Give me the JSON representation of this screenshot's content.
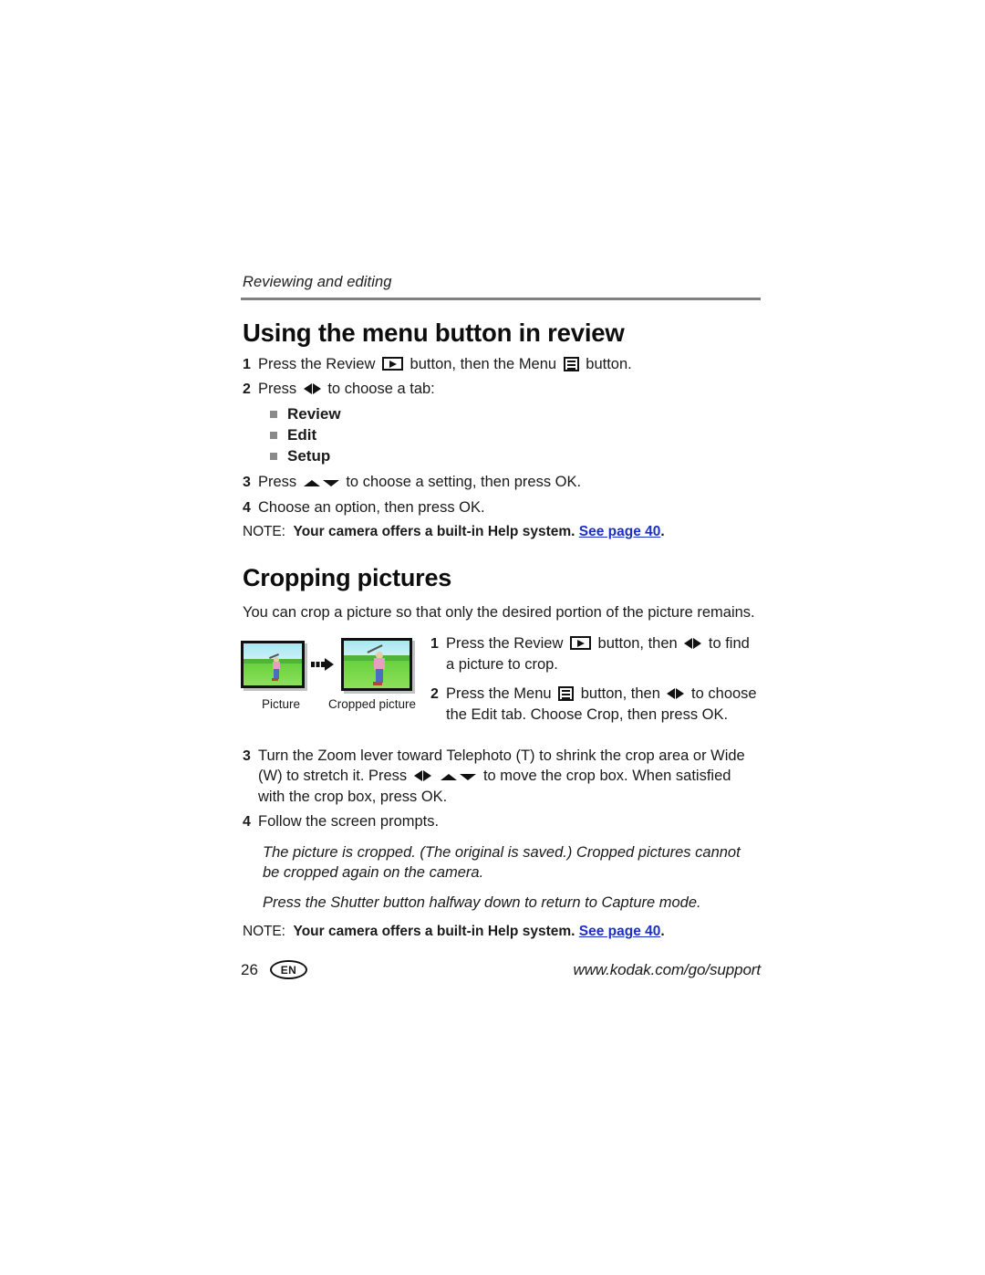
{
  "page": {
    "running_header": "Reviewing and editing",
    "page_number": "26",
    "language_badge": "EN",
    "footer_url": "www.kodak.com/go/support"
  },
  "colors": {
    "link_blue": "#1c2fc8",
    "rule_gray": "#808080",
    "bullet_gray": "#8a8a8a",
    "text": "#1a1a1a"
  },
  "section_menu": {
    "title": "Using the menu button in review",
    "steps": [
      {
        "num": "1",
        "parts": {
          "p1": "Press the Review ",
          "icon1": "review-button-icon",
          "p2": " button, then the Menu ",
          "icon2": "menu-button-icon",
          "p3": " button."
        }
      },
      {
        "num": "2",
        "parts": {
          "p1": "Press ",
          "icon1": "left-right-arrows-icon",
          "p2": " to choose a tab:"
        }
      },
      {
        "num": "3",
        "parts": {
          "p1": "Press ",
          "icon1": "up-down-arrows-icon",
          "p2": " to choose a setting, then press OK."
        }
      },
      {
        "num": "4",
        "parts": {
          "p1": "Choose an option, then press OK."
        }
      }
    ],
    "tabs": [
      {
        "label": "Review"
      },
      {
        "label": "Edit"
      },
      {
        "label": "Setup"
      }
    ],
    "note": {
      "label": "NOTE:",
      "bold_text": "Your camera offers a built-in Help system.",
      "link_text": "See page 40",
      "tail": "."
    }
  },
  "section_crop": {
    "title": "Cropping pictures",
    "intro": "You can crop a picture so that only the desired portion of the picture remains.",
    "figure": {
      "caption_before": "Picture",
      "caption_after": "Cropped picture",
      "arrow": "right-arrow-icon"
    },
    "steps": [
      {
        "num": "1",
        "parts": {
          "p1": "Press the Review ",
          "icon1": "review-button-icon",
          "p2": " button, then ",
          "icon2": "left-right-arrows-icon",
          "p3": " to find a picture to crop."
        }
      },
      {
        "num": "2",
        "parts": {
          "p1": "Press the Menu ",
          "icon1": "menu-button-icon",
          "p2": " button, then ",
          "icon2": "left-right-arrows-icon",
          "p3": " to choose the Edit tab. Choose Crop, then press OK."
        }
      },
      {
        "num": "3",
        "parts": {
          "p1": "Turn the Zoom lever toward Telephoto (T) to shrink the crop area or Wide (W) to stretch it. Press ",
          "icon1": "left-right-arrows-icon",
          "p2": " ",
          "icon2": "up-down-arrows-icon",
          "p3": " to move the crop box. When satisfied with the crop box, press OK."
        }
      },
      {
        "num": "4",
        "parts": {
          "p1": "Follow the screen prompts."
        }
      }
    ],
    "italic_notes": [
      "The picture is cropped. (The original is saved.) Cropped pictures cannot be cropped again on the camera.",
      "Press the Shutter button halfway down to return to Capture mode."
    ],
    "note": {
      "label": "NOTE:",
      "bold_text": "Your camera offers a built-in Help system.",
      "link_text": "See page 40",
      "tail": "."
    }
  }
}
